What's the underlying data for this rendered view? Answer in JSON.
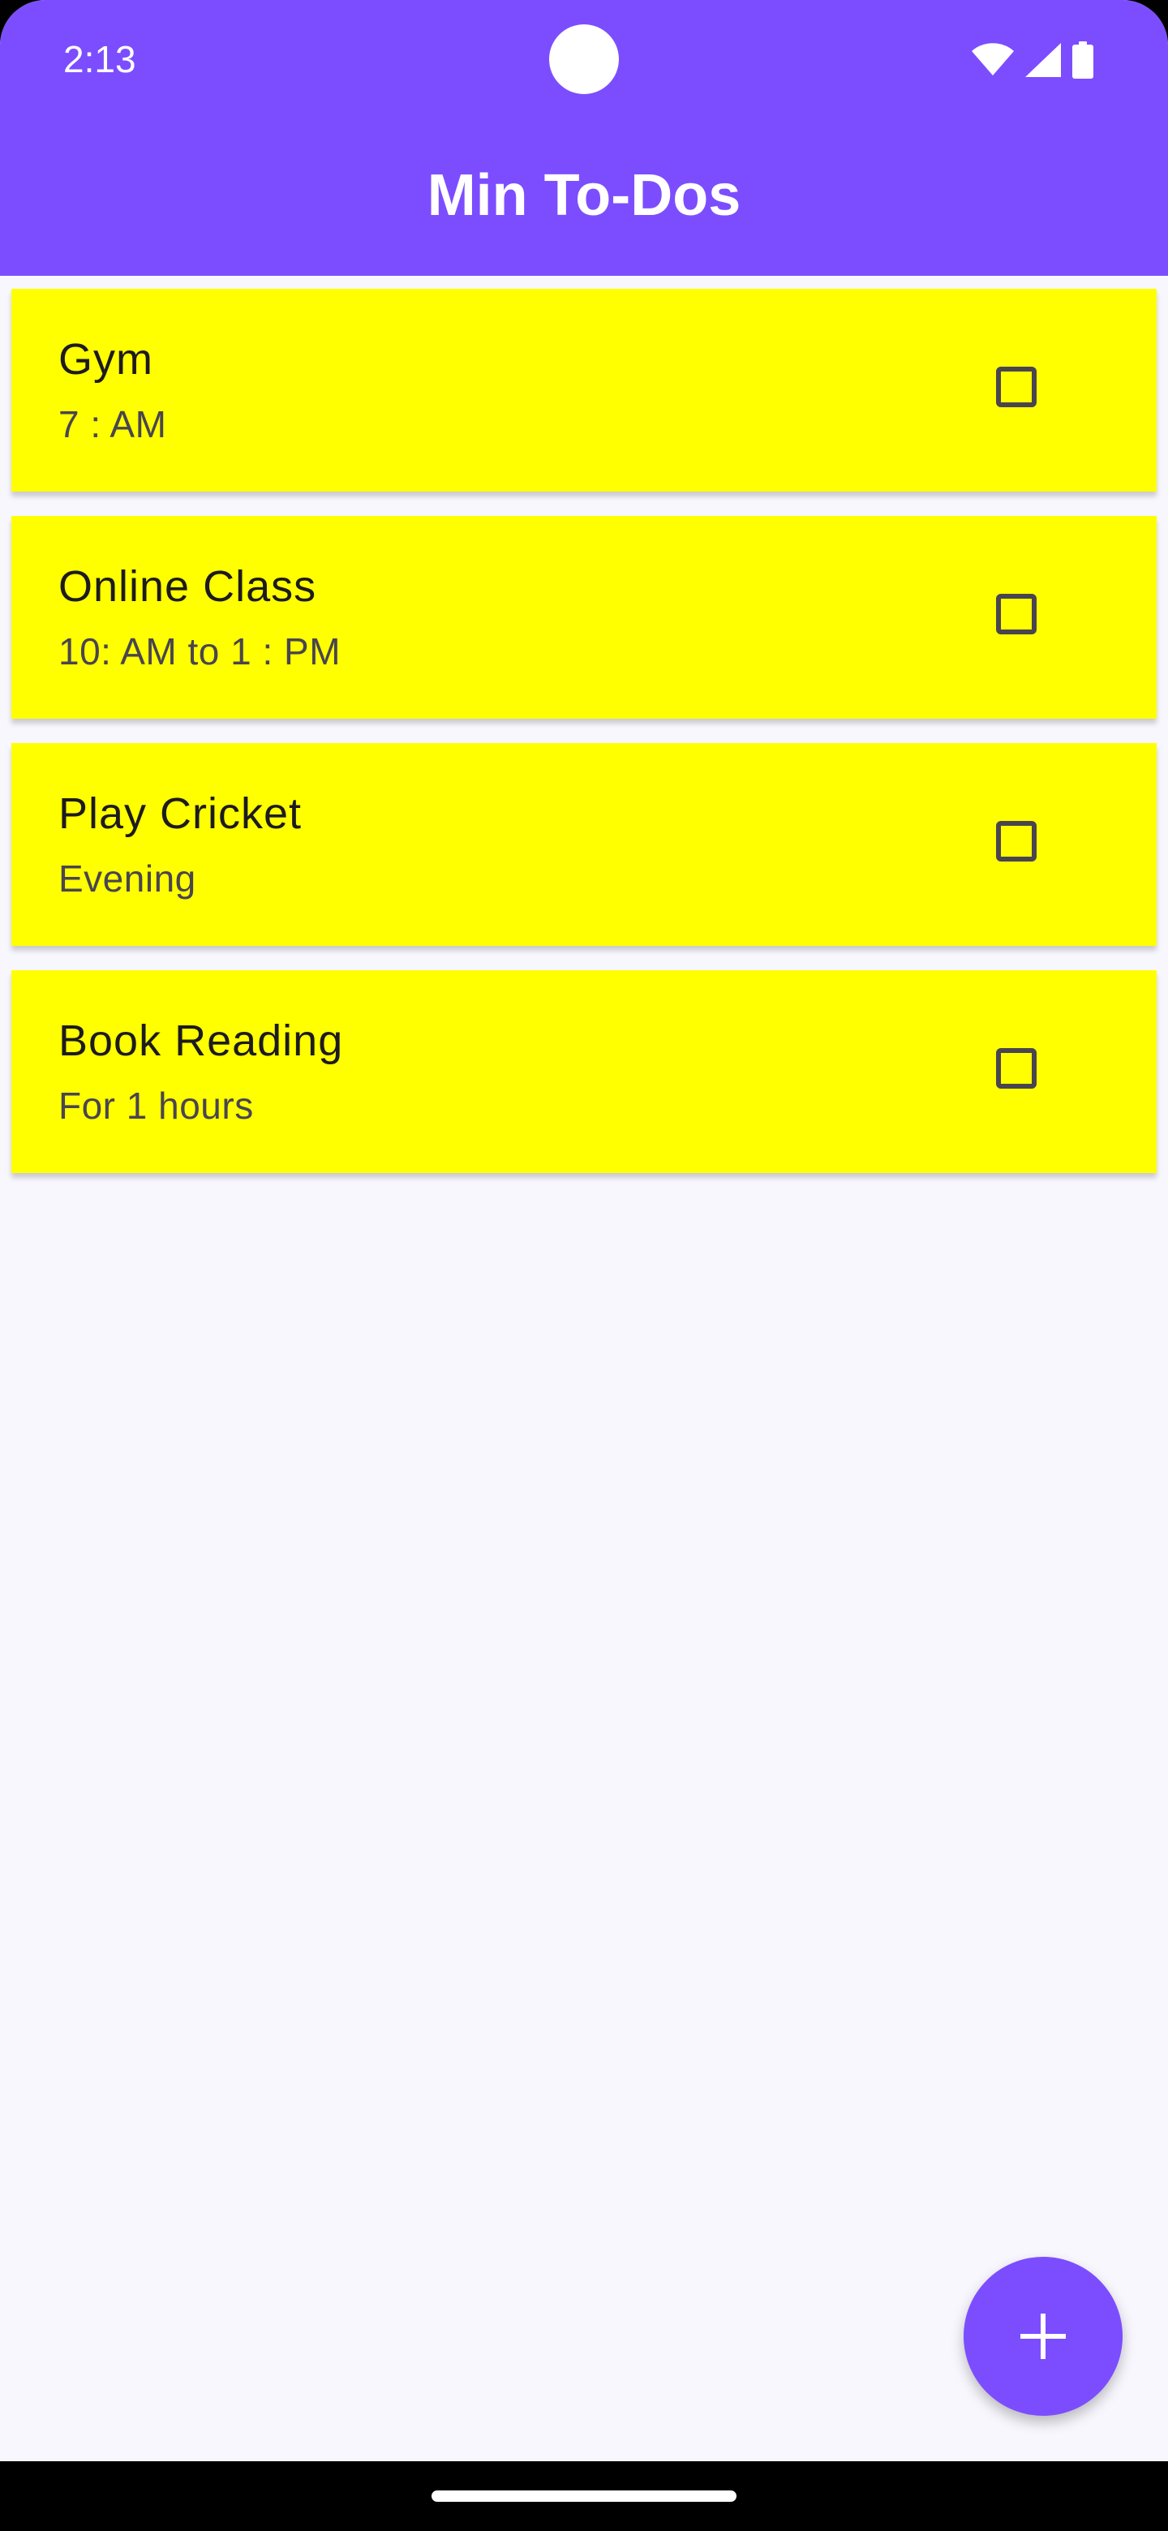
{
  "status_bar": {
    "time": "2:13",
    "icons": [
      "wifi-icon",
      "cellular-signal-icon",
      "battery-icon"
    ]
  },
  "app_bar": {
    "title": "Min To-Dos",
    "color": "#7c4dff"
  },
  "todos": [
    {
      "title": "Gym",
      "subtitle": "7 : AM",
      "checked": false
    },
    {
      "title": "Online Class",
      "subtitle": "10: AM to 1 : PM",
      "checked": false
    },
    {
      "title": "Play Cricket",
      "subtitle": "Evening",
      "checked": false
    },
    {
      "title": "Book Reading",
      "subtitle": "For 1 hours",
      "checked": false
    }
  ],
  "card_color": "#ffff00",
  "fab": {
    "icon": "plus-icon",
    "color": "#7c4dff"
  }
}
